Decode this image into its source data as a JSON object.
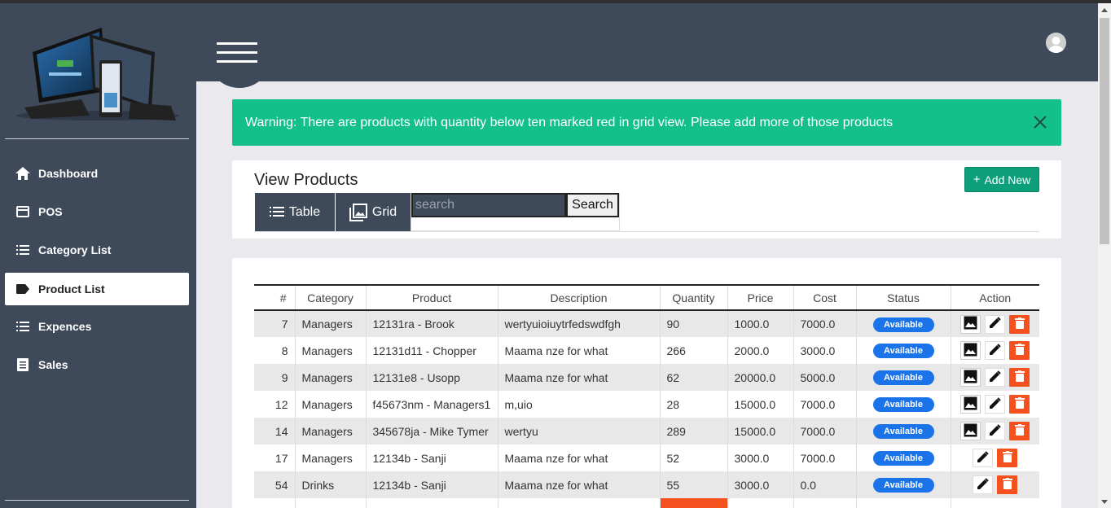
{
  "sidebar": {
    "items": [
      {
        "label": "Dashboard",
        "icon": "home-icon"
      },
      {
        "label": "POS",
        "icon": "card-icon"
      },
      {
        "label": "Category List",
        "icon": "list-icon"
      },
      {
        "label": "Product List",
        "icon": "tag-icon",
        "active": true
      },
      {
        "label": "Expences",
        "icon": "list-icon"
      },
      {
        "label": "Sales",
        "icon": "receipt-icon"
      }
    ]
  },
  "alert": {
    "message": "Warning: There are products with quantity below ten marked red in grid view. Please add more of those products",
    "color": "#14c08a"
  },
  "products": {
    "title": "View Products",
    "add_label": "Add New",
    "tabs": {
      "table": "Table",
      "grid": "Grid"
    },
    "search_placeholder": "search",
    "search_button": "Search"
  },
  "table": {
    "headers": [
      "#",
      "Category",
      "Product",
      "Description",
      "Quantity",
      "Price",
      "Cost",
      "Status",
      "Action"
    ],
    "rows": [
      {
        "id": "7",
        "category": "Managers",
        "product": "12131ra - Brook",
        "description": "wertyuioiuytrfedswdfgh",
        "quantity": "90",
        "price": "1000.0",
        "cost": "7000.0",
        "status": "Available",
        "has_image": true
      },
      {
        "id": "8",
        "category": "Managers",
        "product": "12131d11 - Chopper",
        "description": "Maama nze for what",
        "quantity": "266",
        "price": "2000.0",
        "cost": "3000.0",
        "status": "Available",
        "has_image": true
      },
      {
        "id": "9",
        "category": "Managers",
        "product": "12131e8 - Usopp",
        "description": "Maama nze for what",
        "quantity": "62",
        "price": "20000.0",
        "cost": "5000.0",
        "status": "Available",
        "has_image": true
      },
      {
        "id": "12",
        "category": "Managers",
        "product": "f45673nm - Managers1",
        "description": "m,uio",
        "quantity": "28",
        "price": "15000.0",
        "cost": "7000.0",
        "status": "Available",
        "has_image": true
      },
      {
        "id": "14",
        "category": "Managers",
        "product": "345678ja - Mike Tymer",
        "description": "wertyu",
        "quantity": "289",
        "price": "15000.0",
        "cost": "7000.0",
        "status": "Available",
        "has_image": true
      },
      {
        "id": "17",
        "category": "Managers",
        "product": "12134b - Sanji",
        "description": "Maama nze for what",
        "quantity": "52",
        "price": "3000.0",
        "cost": "7000.0",
        "status": "Available",
        "has_image": false
      },
      {
        "id": "54",
        "category": "Drinks",
        "product": "12134b - Sanji",
        "description": "Maama nze for what",
        "quantity": "55",
        "price": "3000.0",
        "cost": "0.0",
        "status": "Available",
        "has_image": false
      }
    ],
    "low_stock_color": "#f4511e",
    "status_color": "#1a73e8"
  }
}
